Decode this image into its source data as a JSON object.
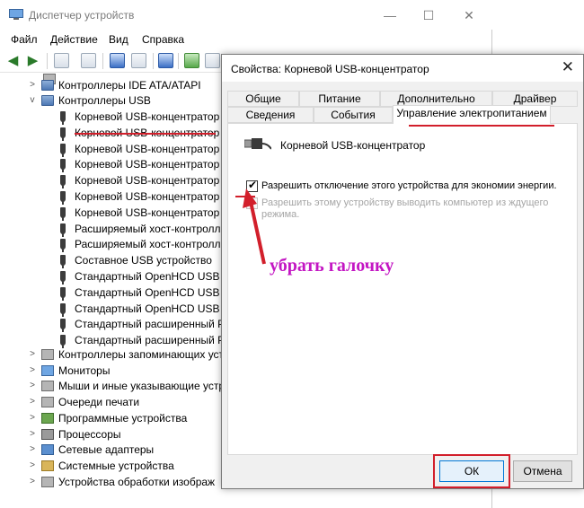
{
  "device_manager": {
    "title": "Диспетчер устройств",
    "window_controls": {
      "minimize": "—",
      "maximize": "☐",
      "close": "✕"
    },
    "menu": [
      "Файл",
      "Действие",
      "Вид",
      "Справка"
    ],
    "toolbar_icons": [
      "back-arrow-icon",
      "forward-arrow-icon",
      "properties-icon",
      "tree-view-icon",
      "help-icon",
      "display-icon",
      "scan-hardware-icon",
      "update-driver-icon",
      "disable-device-icon"
    ],
    "tree": {
      "partial_top": "...",
      "ide": "Контроллеры IDE ATA/ATAPI",
      "usb": "Контроллеры USB",
      "usb_children": [
        "Корневой USB-концентратор",
        "Корневой USB-концентратор",
        "Корневой USB-концентратор",
        "Корневой USB-концентратор",
        "Корневой USB-концентратор",
        "Корневой USB-концентратор",
        "Корневой USB-концентратор",
        "Расширяемый хост-контролл",
        "Расширяемый хост-контролл",
        "Составное USB устройство",
        "Стандартный OpenHCD USB х",
        "Стандартный OpenHCD USB х",
        "Стандартный OpenHCD USB х",
        "Стандартный расширенный P",
        "Стандартный расширенный P"
      ],
      "after": [
        "Контроллеры запоминающих уст",
        "Мониторы",
        "Мыши и иные указывающие устр",
        "Очереди печати",
        "Программные устройства",
        "Процессоры",
        "Сетевые адаптеры",
        "Системные устройства",
        "Устройства обработки изображ"
      ]
    }
  },
  "dialog": {
    "title": "Свойства: Корневой USB-концентратор",
    "close": "✕",
    "tabs_row1": [
      "Общие",
      "Питание",
      "Дополнительно",
      "Драйвер"
    ],
    "tabs_row2": [
      "Сведения",
      "События",
      "Управление электропитанием"
    ],
    "active_tab": "Управление электропитанием",
    "device_name": "Корневой USB-концентратор",
    "option1": {
      "label": "Разрешить отключение этого устройства для экономии энергии.",
      "checked": true
    },
    "option2": {
      "label_line1": "Разрешить этому устройству выводить компьютер из ждущего",
      "label_line2": "режима.",
      "checked": false,
      "enabled": false
    },
    "ok": "ОК",
    "cancel": "Отмена"
  },
  "annotation": {
    "text": "убрать галочку",
    "color": "#c316c3",
    "highlight_color": "#d21f2b"
  }
}
